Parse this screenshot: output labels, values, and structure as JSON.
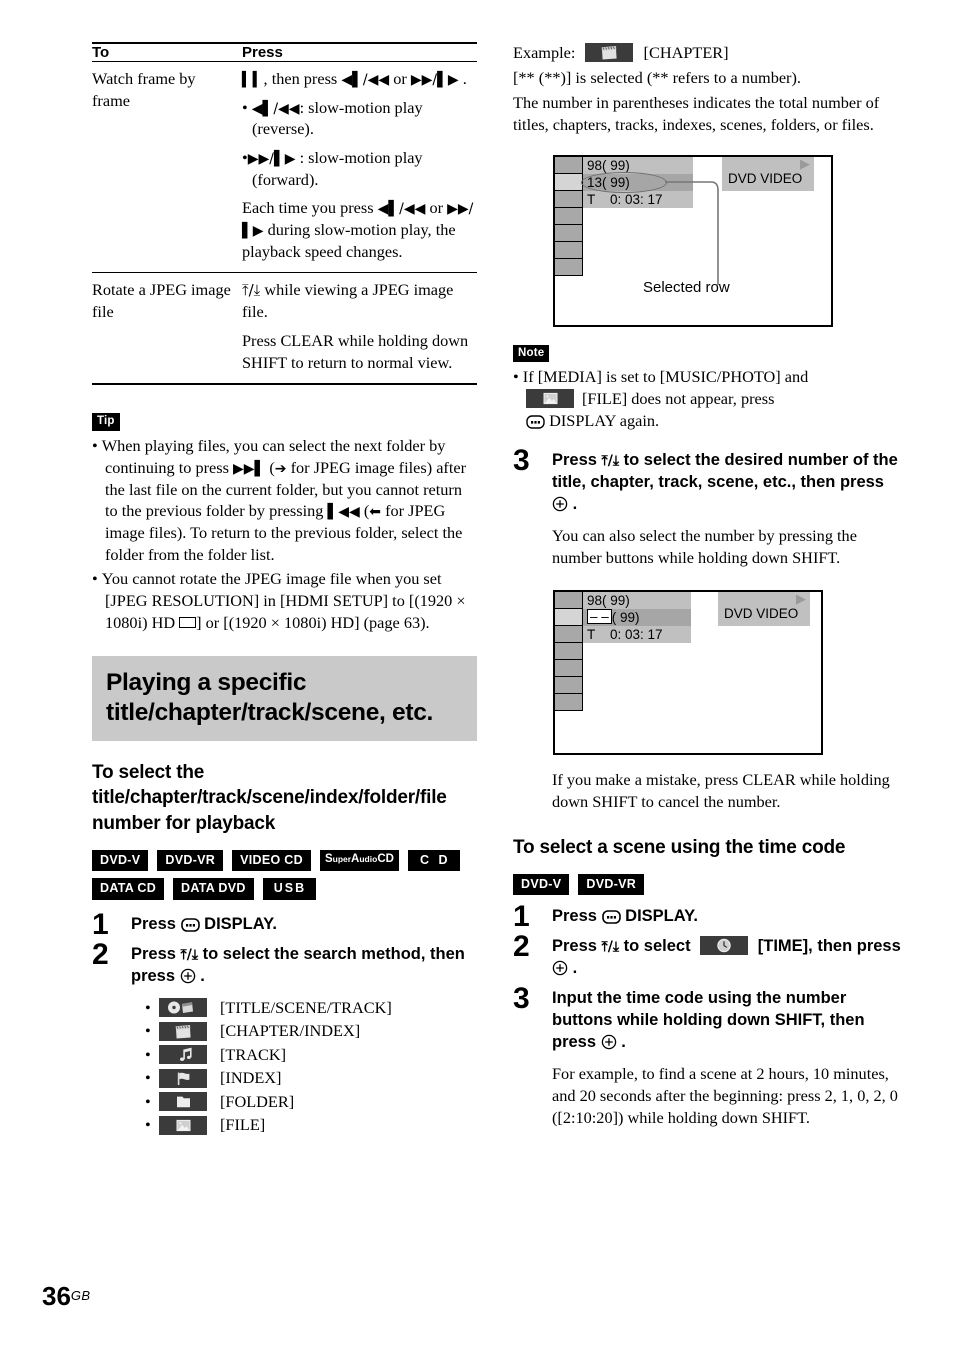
{
  "page": {
    "number": "36",
    "suffix": "GB"
  },
  "left_column": {
    "table": {
      "headers": [
        "To",
        "Press"
      ],
      "rows": [
        {
          "to": "Watch frame by frame",
          "press": [
            "⏸, then press ◀❙/◀◀ or ▶▶/❙▶ .",
            "• ◀❙/◀◀: slow-motion play (reverse).",
            "• ▶▶/❙▶ : slow-motion play (forward).",
            "Each time you press ◀❙/◀◀ or ▶▶/❙▶ during slow-motion play, the playback speed changes."
          ]
        },
        {
          "to": "Rotate a JPEG image file",
          "press": [
            "↑/↓ while viewing a JPEG image file.",
            "Press CLEAR while holding down SHIFT to return to normal view."
          ]
        }
      ]
    },
    "tip": {
      "label": "Tip",
      "items": [
        "When playing files, you can select the next folder by continuing to press ▶▶❙ (→ for JPEG image files) after the last file on the current folder, but you cannot return to the previous folder by pressing ❙◀◀ (← for JPEG image files). To return to the previous folder, select the folder from the folder list.",
        "You cannot rotate the JPEG image file when you set [JPEG RESOLUTION] in [HDMI SETUP] to [(1920 × 1080i) HD ▭] or [(1920 × 1080i) HD] (page 63)."
      ]
    },
    "section_heading": "Playing a specific title/chapter/track/scene, etc.",
    "subheading": "To select the title/chapter/track/scene/index/folder/file number for playback",
    "disc_badges_row1": [
      "DVD-V",
      "DVD-VR",
      "VIDEO CD",
      "Super Audio CD",
      "C D"
    ],
    "disc_badges_row2": [
      "DATA CD",
      "DATA DVD",
      "USB"
    ],
    "steps": [
      {
        "num": "1",
        "lead_before": "Press",
        "lead_icon": "display-icon",
        "lead_after": "DISPLAY."
      },
      {
        "num": "2",
        "lead": "Press ↑/↓ to select the search method, then press ⊕ ."
      }
    ],
    "search_methods": [
      {
        "icon": "title-scene-track-icon",
        "label": "[TITLE/SCENE/TRACK]"
      },
      {
        "icon": "chapter-index-icon",
        "label": "[CHAPTER/INDEX]"
      },
      {
        "icon": "track-icon",
        "label": "[TRACK]"
      },
      {
        "icon": "index-icon",
        "label": "[INDEX]"
      },
      {
        "icon": "folder-icon",
        "label": "[FOLDER]"
      },
      {
        "icon": "file-icon",
        "label": "[FILE]"
      }
    ]
  },
  "right_column": {
    "example_prefix": "Example:",
    "example_label": "[CHAPTER]",
    "example_lines": [
      "[** (**)] is selected (** refers to a number).",
      "The number in parentheses indicates the total number of titles, chapters, tracks, indexes, scenes, folders, or files."
    ],
    "osd_1": {
      "row_total": "98( 99)",
      "row_selected": "13( 99)",
      "row_time": "T    0: 03: 17",
      "disc_type": "DVD VIDEO",
      "play_icon": "▶",
      "callout": "Selected row"
    },
    "note": {
      "label": "Note",
      "text_before": "If [MEDIA] is set to [MUSIC/PHOTO] and",
      "icon": "file-icon",
      "text_middle": "[FILE] does not appear, press",
      "icon2": "display-icon",
      "text_after": "DISPLAY again."
    },
    "step3": {
      "num": "3",
      "lead": "Press ↑/↓ to select the desired number of the title, chapter, track, scene, etc., then press ⊕ .",
      "expl": "You can also select the number by pressing the number buttons while holding down SHIFT."
    },
    "osd_2": {
      "row_total": "98( 99)",
      "row_selected_dashes": "– –",
      "row_selected_rest": "( 99)",
      "row_time": "T    0: 03: 17",
      "disc_type": "DVD VIDEO",
      "play_icon": "▶"
    },
    "mistake_text": "If you make a mistake, press CLEAR while holding down SHIFT to cancel the number.",
    "time_heading": "To select a scene using the time code",
    "time_badges": [
      "DVD-V",
      "DVD-VR"
    ],
    "time_steps": [
      {
        "num": "1",
        "lead_before": "Press",
        "lead_icon": "display-icon",
        "lead_after": "DISPLAY."
      },
      {
        "num": "2",
        "lead_before": "Press ↑/↓ to select",
        "lead_icon": "time-icon",
        "lead_after": "[TIME], then press ⊕ ."
      },
      {
        "num": "3",
        "lead": "Input the time code using the number buttons while holding down SHIFT, then press ⊕ ."
      }
    ],
    "time_expl": "For example, to find a scene at 2 hours, 10 minutes, and 20 seconds after the beginning: press 2, 1, 0, 2, 0 ([2:10:20]) while holding down SHIFT."
  }
}
